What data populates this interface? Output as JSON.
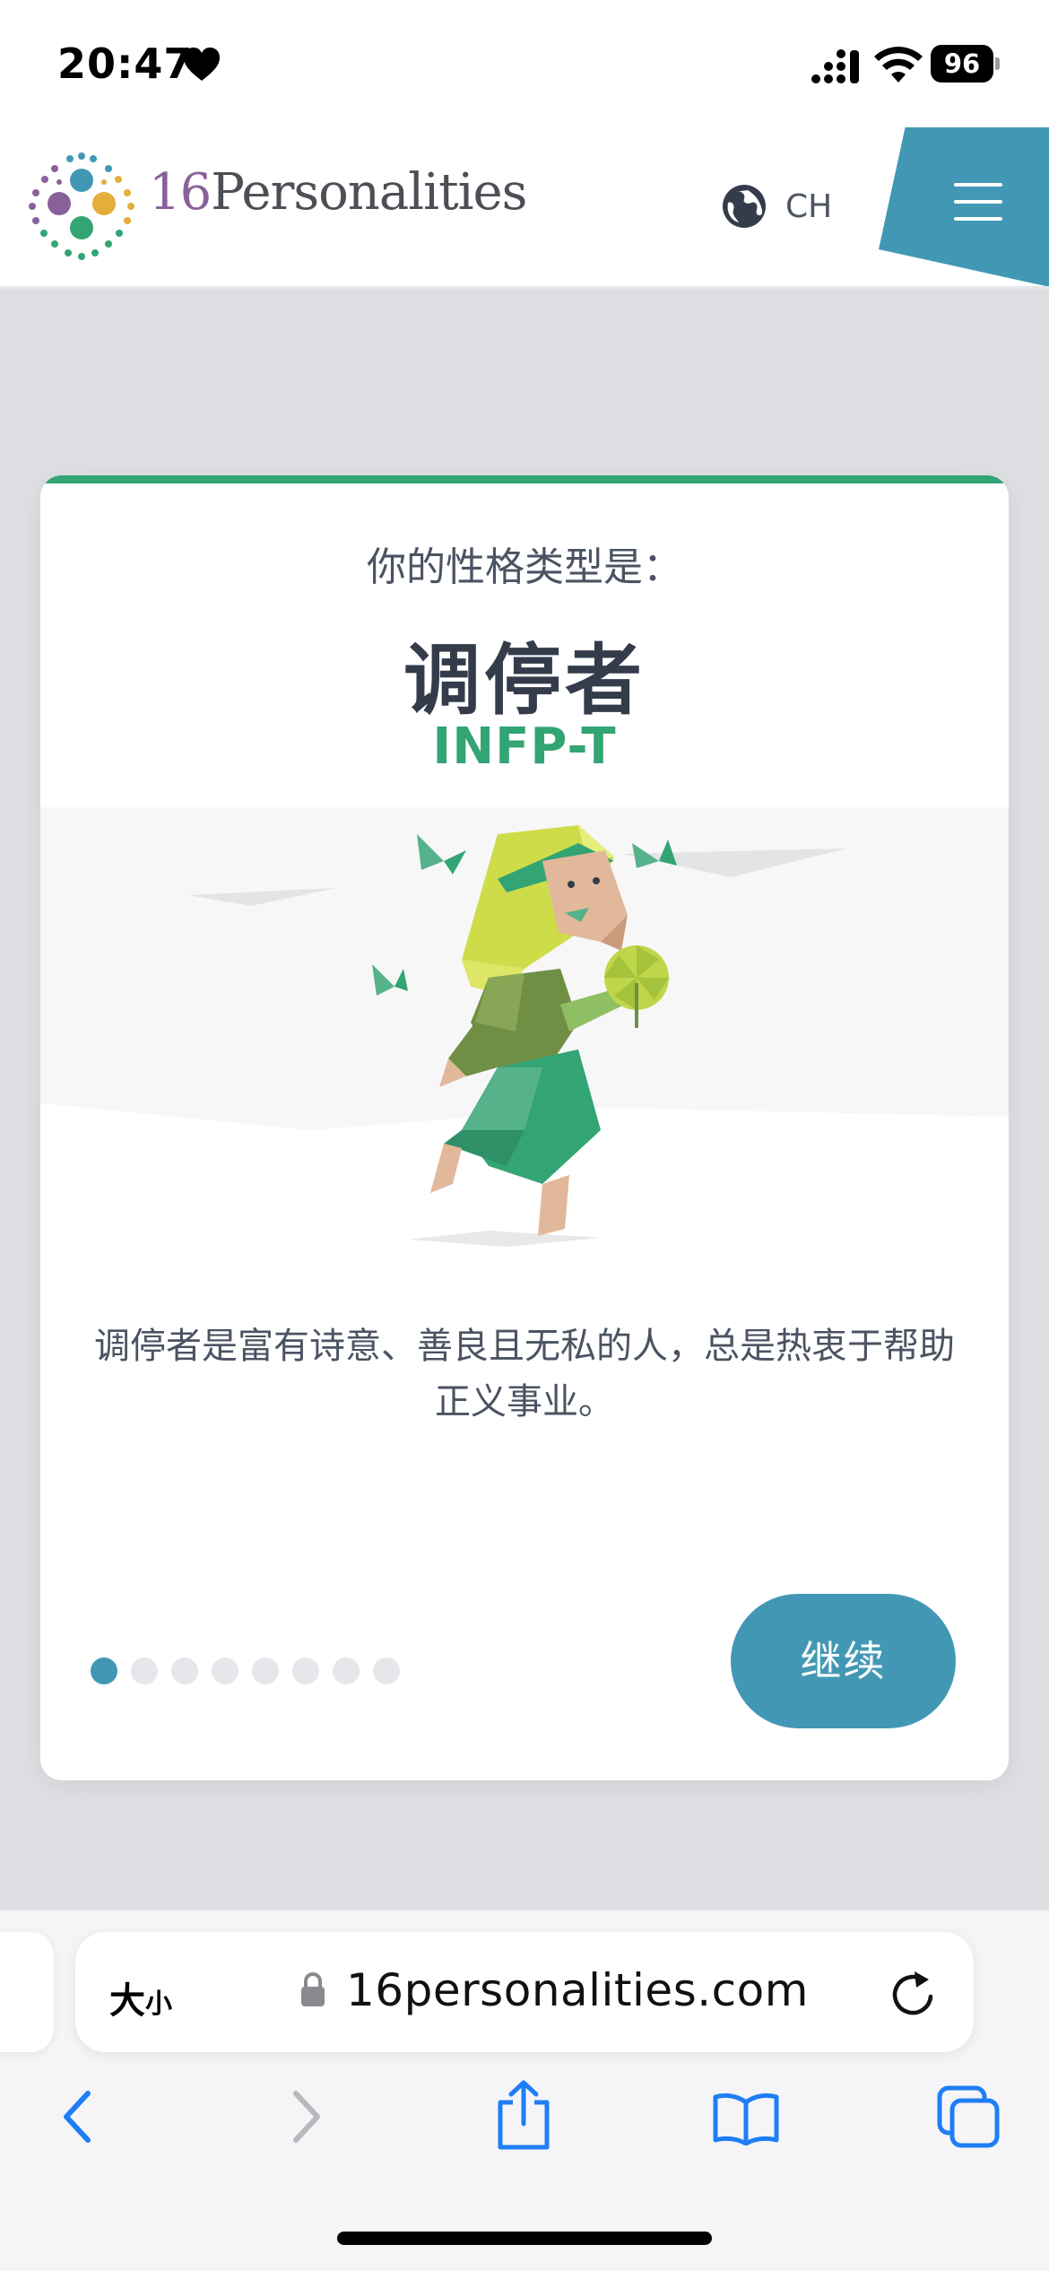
{
  "status_bar": {
    "time": "20:47",
    "battery_level": "96",
    "icons": [
      "heart-icon",
      "cellular-signal-icon",
      "wifi-icon",
      "battery-icon"
    ]
  },
  "header": {
    "logo_number": "16",
    "logo_word": "Personalities",
    "language_code": "CH",
    "icons": [
      "logo-dots-icon",
      "globe-icon",
      "hamburger-menu-icon"
    ],
    "accent_color": "#4298b4"
  },
  "card": {
    "lead": "你的性格类型是：",
    "type_name": "调停者",
    "type_code": "INFP-T",
    "description": "调停者是富有诗意、善良且无私的人，总是热衷于帮助正义事业。",
    "pager": {
      "total": 8,
      "current": 1
    },
    "continue_label": "继续",
    "accent_color": "#33a474"
  },
  "browser": {
    "text_size_big": "大",
    "text_size_small": "小",
    "url": "16personalities.com",
    "icons": [
      "lock-icon",
      "reload-icon",
      "back-icon",
      "forward-icon",
      "share-icon",
      "bookmarks-icon",
      "tabs-icon"
    ],
    "tint_color": "#1f7ef5"
  }
}
